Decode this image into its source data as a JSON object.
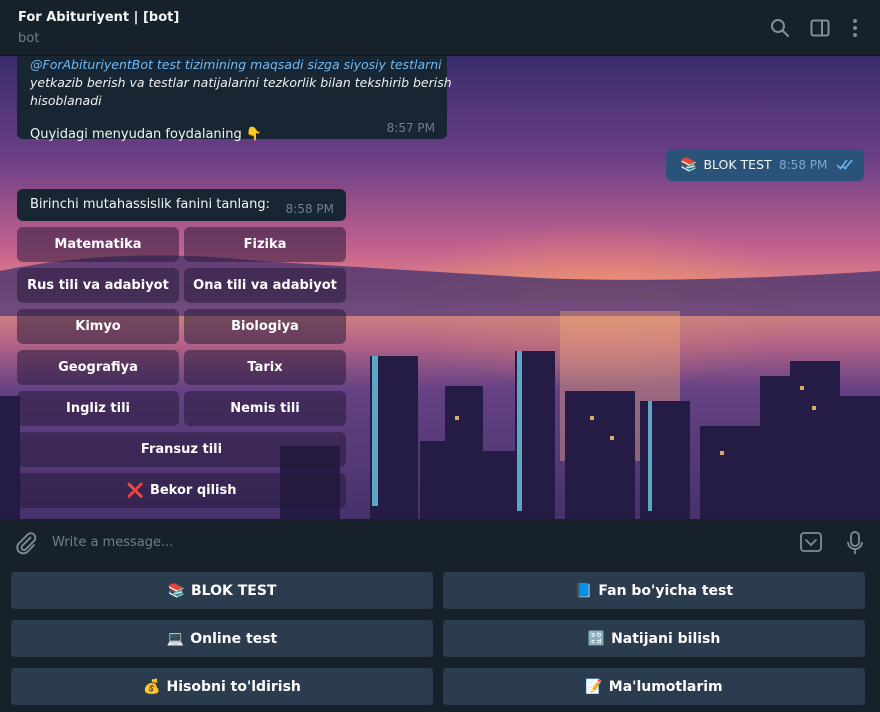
{
  "header": {
    "title": "For Abituriyent | [bot]",
    "status": "bot"
  },
  "messages": {
    "first": {
      "line_link": "@ForAbituriyentBot test tizimining maqsadi sizga siyosiy testlarni",
      "line2": "yetkazib berish va testlar natijalarini tezkorlik bilan tekshirib berish",
      "line3": "hisoblanadi",
      "plain": "Quyidagi menyudan foydalaning",
      "plain_emoji": "👇",
      "time": "8:57 PM"
    },
    "outgoing": {
      "emoji": "📚",
      "text": "BLOK TEST",
      "time": "8:58 PM"
    },
    "second": {
      "text": "Birinchi mutahassislik fanini tanlang:",
      "time": "8:58 PM"
    }
  },
  "inline_keyboard": {
    "matematika": "Matematika",
    "fizika": "Fizika",
    "rus": "Rus tili va adabiyot",
    "ona": "Ona tili va adabiyot",
    "kimyo": "Kimyo",
    "biologiya": "Biologiya",
    "geografiya": "Geografiya",
    "tarix": "Tarix",
    "ingliz": "Ingliz tili",
    "nemis": "Nemis tili",
    "fransuz": "Fransuz tili",
    "cancel_emoji": "❌",
    "cancel": "Bekor qilish"
  },
  "input": {
    "placeholder": "Write a message..."
  },
  "reply_keyboard": {
    "blok_emoji": "📚",
    "blok": "BLOK TEST",
    "fan_emoji": "📘",
    "fan": "Fan bo'yicha test",
    "online_emoji": "💻",
    "online": "Online test",
    "natija_emoji": "🔡",
    "natija": "Natijani bilish",
    "hisob_emoji": "💰",
    "hisob": "Hisobni to'ldirish",
    "malumot_emoji": "📝",
    "malumot": "Ma'lumotlarim"
  },
  "colors": {
    "accent": "#71baf7",
    "bubble_in": "#182533",
    "bubble_out": "#2b5278",
    "panel": "#17212b",
    "reply_button": "#2b3c4e"
  },
  "icons": [
    "search-icon",
    "sidebar-toggle-icon",
    "more-vertical-icon",
    "paperclip-icon",
    "keyboard-toggle-icon",
    "microphone-icon",
    "double-check-icon"
  ]
}
